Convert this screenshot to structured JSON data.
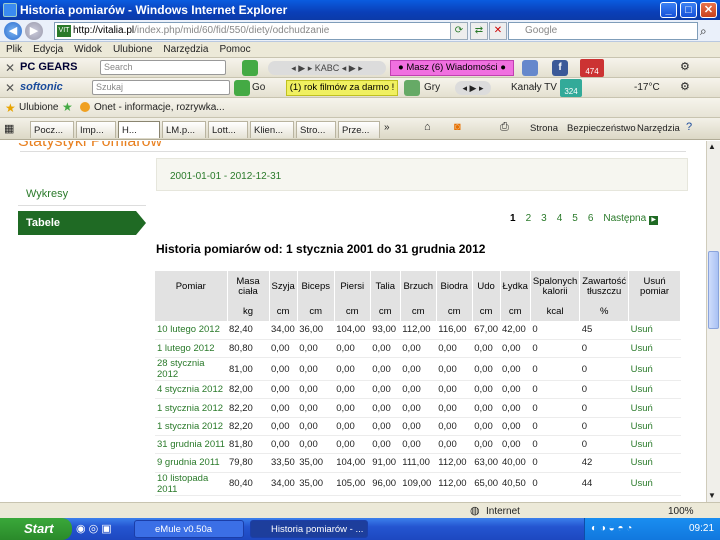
{
  "window": {
    "title": "Historia pomiarów - Windows Internet Explorer"
  },
  "address": {
    "domain": "http://vitalia.pl",
    "path": "/index.php/mid/60/fid/550/diety/odchudzanie",
    "search_placeholder": "Google"
  },
  "menu": [
    "Plik",
    "Edycja",
    "Widok",
    "Ulubione",
    "Narzędzia",
    "Pomoc"
  ],
  "toolbar1": {
    "brand": "PC GEARS",
    "search_placeholder": "Search",
    "radio": "KABC",
    "mail": "● Masz (6) Wiadomości ●",
    "badge": "474"
  },
  "toolbar2": {
    "brand": "softonic",
    "search_placeholder": "Szukaj",
    "go": "Go",
    "promo": "(1) rok filmów za darmo !",
    "games": "Gry",
    "tv": "Kanały TV",
    "badge": "324",
    "temp": "-17°C"
  },
  "favorites": {
    "label": "Ulubione",
    "link": "Onet - informacje, rozrywka..."
  },
  "tabs": [
    "Pocz...",
    "Imp...",
    "H...",
    "LM.p...",
    "Lott...",
    "Klien...",
    "Stro...",
    "Prze..."
  ],
  "cmdbar": {
    "page": "Strona",
    "security": "Bezpieczeństwo",
    "tools": "Narzędzia"
  },
  "page": {
    "heading": "Statystyki Pomiarów",
    "sidebar": {
      "charts": "Wykresy",
      "tables": "Tabele"
    },
    "date_range": "2001-01-01 - 2012-12-31",
    "pager": {
      "pages": [
        "1",
        "2",
        "3",
        "4",
        "5",
        "6"
      ],
      "current": "1",
      "next": "Następna"
    },
    "title": "Historia pomiarów od: 1 stycznia 2001 do 31 grudnia 2012",
    "table": {
      "headers": [
        "Pomiar",
        "Masa ciała",
        "Szyja",
        "Biceps",
        "Piersi",
        "Talia",
        "Brzuch",
        "Biodra",
        "Udo",
        "Łydka",
        "Spalonych kalorii",
        "Zawartość tłuszczu",
        "Usuń pomiar"
      ],
      "units": [
        "",
        "kg",
        "cm",
        "cm",
        "cm",
        "cm",
        "cm",
        "cm",
        "cm",
        "cm",
        "kcal",
        "%",
        ""
      ],
      "rows": [
        [
          "10 lutego 2012",
          "82,40",
          "34,00",
          "36,00",
          "104,00",
          "93,00",
          "112,00",
          "116,00",
          "67,00",
          "42,00",
          "0",
          "45",
          "Usuń"
        ],
        [
          "1 lutego 2012",
          "80,80",
          "0,00",
          "0,00",
          "0,00",
          "0,00",
          "0,00",
          "0,00",
          "0,00",
          "0,00",
          "0",
          "0",
          "Usuń"
        ],
        [
          "28 stycznia 2012",
          "81,00",
          "0,00",
          "0,00",
          "0,00",
          "0,00",
          "0,00",
          "0,00",
          "0,00",
          "0,00",
          "0",
          "0",
          "Usuń"
        ],
        [
          "4 stycznia 2012",
          "82,00",
          "0,00",
          "0,00",
          "0,00",
          "0,00",
          "0,00",
          "0,00",
          "0,00",
          "0,00",
          "0",
          "0",
          "Usuń"
        ],
        [
          "1 stycznia 2012",
          "82,20",
          "0,00",
          "0,00",
          "0,00",
          "0,00",
          "0,00",
          "0,00",
          "0,00",
          "0,00",
          "0",
          "0",
          "Usuń"
        ],
        [
          "1 stycznia 2012",
          "82,20",
          "0,00",
          "0,00",
          "0,00",
          "0,00",
          "0,00",
          "0,00",
          "0,00",
          "0,00",
          "0",
          "0",
          "Usuń"
        ],
        [
          "31 grudnia 2011",
          "81,80",
          "0,00",
          "0,00",
          "0,00",
          "0,00",
          "0,00",
          "0,00",
          "0,00",
          "0,00",
          "0",
          "0",
          "Usuń"
        ],
        [
          "9 grudnia 2011",
          "79,80",
          "33,50",
          "35,00",
          "104,00",
          "91,00",
          "111,00",
          "112,00",
          "63,00",
          "40,00",
          "0",
          "42",
          "Usuń"
        ],
        [
          "10 listopada 2011",
          "80,40",
          "34,00",
          "35,00",
          "105,00",
          "96,00",
          "109,00",
          "112,00",
          "65,00",
          "40,50",
          "0",
          "44",
          "Usuń"
        ]
      ]
    }
  },
  "status": {
    "zone": "Internet",
    "zoom": "100%"
  },
  "taskbar": {
    "start": "Start",
    "tasks": [
      "eMule v0.50a",
      "Historia pomiarów - ..."
    ],
    "clock": "09:21"
  }
}
